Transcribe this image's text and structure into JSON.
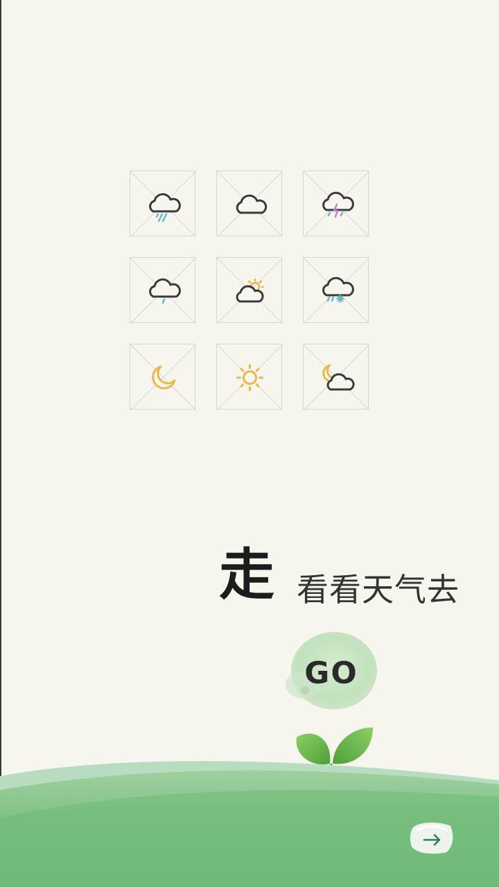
{
  "weather_icons": [
    {
      "name": "rain-cloud-icon",
      "kind": "rain"
    },
    {
      "name": "cloud-icon",
      "kind": "cloud"
    },
    {
      "name": "thunderstorm-icon",
      "kind": "thunder"
    },
    {
      "name": "light-rain-icon",
      "kind": "light-rain"
    },
    {
      "name": "sun-cloud-icon",
      "kind": "sun-cloud"
    },
    {
      "name": "sleet-icon",
      "kind": "sleet"
    },
    {
      "name": "moon-icon",
      "kind": "moon"
    },
    {
      "name": "sun-icon",
      "kind": "sun"
    },
    {
      "name": "moon-cloud-icon",
      "kind": "moon-cloud"
    }
  ],
  "title": {
    "char": "走",
    "subtitle": "看看天气去"
  },
  "go_button": {
    "label": "GO"
  },
  "next_button": {
    "icon": "arrow-right-icon"
  },
  "colors": {
    "background": "#f6f5ee",
    "grass": "#7dbf7e",
    "rain": "#6ab4c8",
    "sun": "#e8b84a",
    "lightning": "#c47ad8",
    "ink": "#3a3a3a"
  }
}
